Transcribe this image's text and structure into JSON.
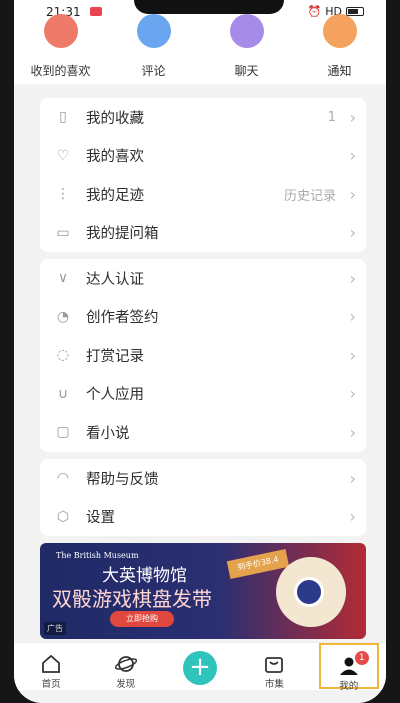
{
  "status_bar": {
    "time": "21:31",
    "network": "HD"
  },
  "quick_actions": [
    {
      "label": "收到的喜欢",
      "color": "#f07a6a",
      "icon": "heart-icon"
    },
    {
      "label": "评论",
      "color": "#6aa6f0",
      "icon": "comment-icon"
    },
    {
      "label": "聊天",
      "color": "#a68be8",
      "icon": "chat-icon"
    },
    {
      "label": "通知",
      "color": "#f5a25e",
      "icon": "bell-icon"
    }
  ],
  "group1": [
    {
      "label": "我的收藏",
      "value": "1",
      "icon": "bookmark-icon"
    },
    {
      "label": "我的喜欢",
      "value": "",
      "icon": "heart-outline-icon"
    },
    {
      "label": "我的足迹",
      "value": "历史记录",
      "icon": "footprint-icon"
    },
    {
      "label": "我的提问箱",
      "value": "",
      "icon": "question-box-icon"
    }
  ],
  "group2": [
    {
      "label": "达人认证",
      "icon": "verified-icon"
    },
    {
      "label": "创作者签约",
      "icon": "contract-icon"
    },
    {
      "label": "打赏记录",
      "icon": "tip-icon"
    },
    {
      "label": "个人应用",
      "icon": "magnet-icon"
    },
    {
      "label": "看小说",
      "icon": "book-icon"
    }
  ],
  "group3": [
    {
      "label": "帮助与反馈",
      "icon": "headset-icon"
    },
    {
      "label": "设置",
      "icon": "settings-icon"
    }
  ],
  "banner": {
    "brand": "The British Museum",
    "title": "大英博物馆",
    "subtitle": "双骰游戏棋盘发带",
    "price": "到手价38.4",
    "button": "立即抢购",
    "ad_tag": "广告"
  },
  "tabs": [
    {
      "label": "首页",
      "icon": "home-icon"
    },
    {
      "label": "发现",
      "icon": "planet-icon"
    },
    {
      "label": "",
      "icon": "add-icon"
    },
    {
      "label": "市集",
      "icon": "bag-icon"
    },
    {
      "label": "我的",
      "icon": "profile-icon",
      "badge": "1"
    }
  ],
  "accent_color": "#2fc4bb"
}
